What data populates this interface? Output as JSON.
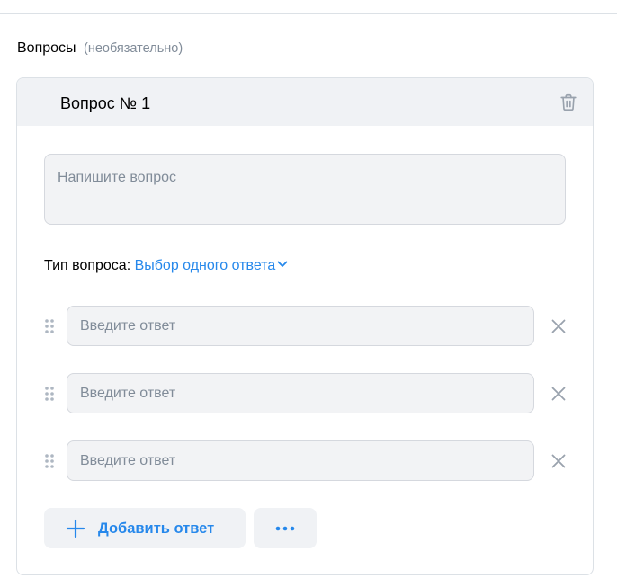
{
  "section": {
    "title": "Вопросы",
    "hint": "(необязательно)"
  },
  "question": {
    "title": "Вопрос № 1",
    "placeholder": "Напишите вопрос",
    "type_label": "Тип вопроса:",
    "type_value": "Выбор одного ответа"
  },
  "answers": [
    {
      "placeholder": "Введите ответ"
    },
    {
      "placeholder": "Введите ответ"
    },
    {
      "placeholder": "Введите ответ"
    }
  ],
  "actions": {
    "add_answer_label": "Добавить ответ"
  },
  "icons": {
    "trash": "trash-icon",
    "chevron": "chevron-down-icon",
    "drag": "drag-handle-icon",
    "remove": "close-icon",
    "add": "plus-icon",
    "more": "more-horizontal-icon"
  },
  "colors": {
    "accent": "#2688eb",
    "muted": "#818c99",
    "field_bg": "#f2f3f5",
    "header_bg": "#f0f2f5"
  }
}
